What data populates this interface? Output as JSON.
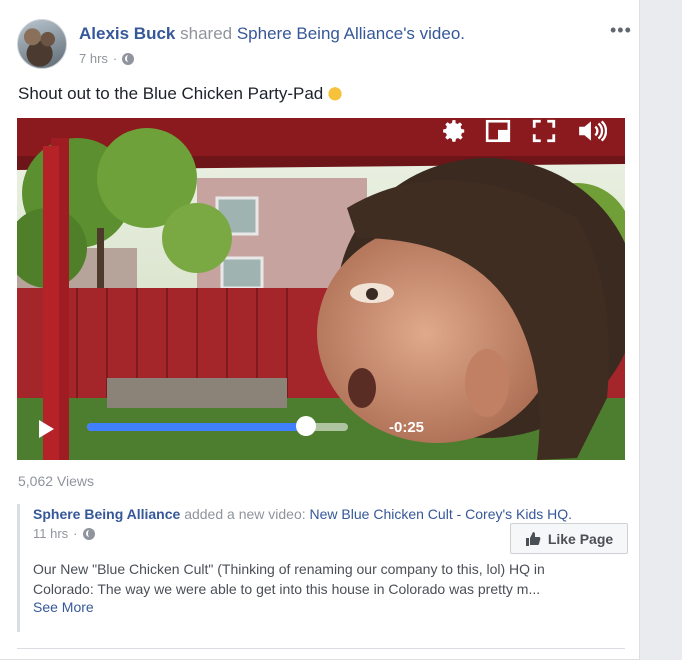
{
  "post": {
    "author": "Alexis Buck",
    "shared_text": "shared",
    "page_name": "Sphere Being Alliance",
    "object_text": "'s video.",
    "time": "7 hrs",
    "dot": "·",
    "status": "Shout out to the Blue Chicken Party-Pad"
  },
  "video": {
    "remaining_time": "-0:25",
    "progress": 0.84,
    "views": "5,062 Views"
  },
  "shared": {
    "page_name": "Sphere Being Alliance",
    "action": "added a new video:",
    "video_title": "New Blue Chicken Cult - Corey's Kids HQ.",
    "time": "11 hrs",
    "dot": "·",
    "like_label": "Like Page",
    "description": "Our New \"Blue Chicken Cult\" (Thinking of renaming our company to this, lol) HQ in Colorado: The way we were able to get into this house in Colorado was pretty m...",
    "see_more": "See More"
  },
  "colors": {
    "link": "#365899",
    "muted": "#90949c",
    "progress": "#4080ff"
  },
  "icons": [
    "globe-icon",
    "more-options-icon",
    "waving-hand-emoji",
    "play-icon",
    "settings-icon",
    "pip-icon",
    "fullscreen-icon",
    "volume-icon",
    "thumbs-up-icon"
  ]
}
